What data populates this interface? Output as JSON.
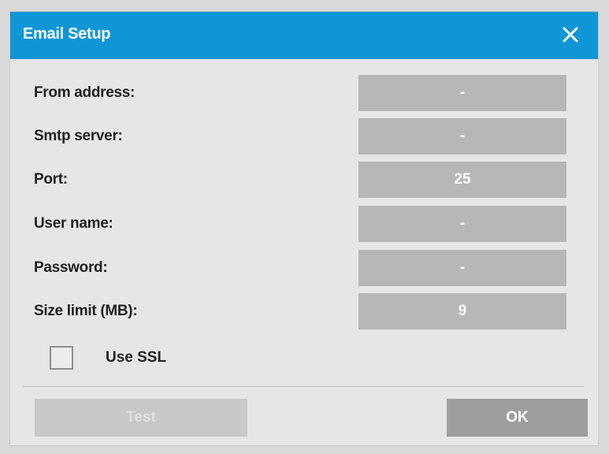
{
  "dialog": {
    "title": "Email Setup",
    "close_icon": "close-icon"
  },
  "fields": [
    {
      "label": "From address:",
      "value": "-"
    },
    {
      "label": "Smtp server:",
      "value": "-"
    },
    {
      "label": "Port:",
      "value": "25"
    },
    {
      "label": "User name:",
      "value": "-"
    },
    {
      "label": "Password:",
      "value": "-"
    },
    {
      "label": "Size limit (MB):",
      "value": "9"
    }
  ],
  "ssl": {
    "label": "Use SSL",
    "checked": false
  },
  "buttons": {
    "test_label": "Test",
    "ok_label": "OK"
  },
  "colors": {
    "titlebar": "#0f96d6",
    "field_bg": "#b7b7b7",
    "dialog_bg": "#e6e6e6"
  }
}
